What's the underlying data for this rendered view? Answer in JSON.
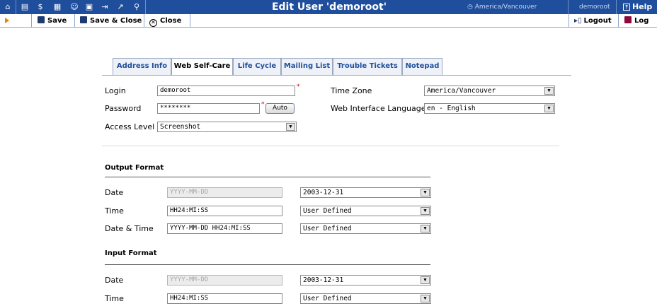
{
  "topbar": {
    "title": "Edit User 'demoroot'",
    "timezone": "America/Vancouver",
    "user": "demoroot",
    "help": "Help",
    "nav_icons": [
      "home-icon",
      "list-icon",
      "dollar-icon",
      "grid-icon",
      "person-icon",
      "card-icon",
      "transfer-icon",
      "chart-icon",
      "search-icon"
    ]
  },
  "toolbar": {
    "save": "Save",
    "save_close": "Save & Close",
    "close": "Close",
    "logout": "Logout",
    "log": "Log"
  },
  "tabs": [
    "Address Info",
    "Web Self-Care",
    "Life Cycle",
    "Mailing List",
    "Trouble Tickets",
    "Notepad"
  ],
  "active_tab": "Web Self-Care",
  "form": {
    "login_label": "Login",
    "login_value": "demoroot",
    "password_label": "Password",
    "password_value": "********",
    "auto_button": "Auto",
    "access_level_label": "Access Level",
    "access_level_value": "Screenshot",
    "timezone_label": "Time Zone",
    "timezone_value": "America/Vancouver",
    "language_label": "Web Interface Language",
    "language_value": "en - English"
  },
  "output_format": {
    "title": "Output Format",
    "rows": [
      {
        "label": "Date",
        "value": "YYYY-MM-DD",
        "select": "2003-12-31"
      },
      {
        "label": "Time",
        "value": "HH24:MI:SS",
        "select": "User Defined"
      },
      {
        "label": "Date & Time",
        "value": "YYYY-MM-DD HH24:MI:SS",
        "select": "User Defined"
      }
    ]
  },
  "input_format": {
    "title": "Input Format",
    "rows": [
      {
        "label": "Date",
        "value": "YYYY-MM-DD",
        "select": "2003-12-31"
      },
      {
        "label": "Time",
        "value": "HH24:MI:SS",
        "select": "User Defined"
      }
    ]
  },
  "colors": {
    "topbar": "#1f4e9c",
    "accent_arrow": "#f08000",
    "required": "#d00000"
  }
}
